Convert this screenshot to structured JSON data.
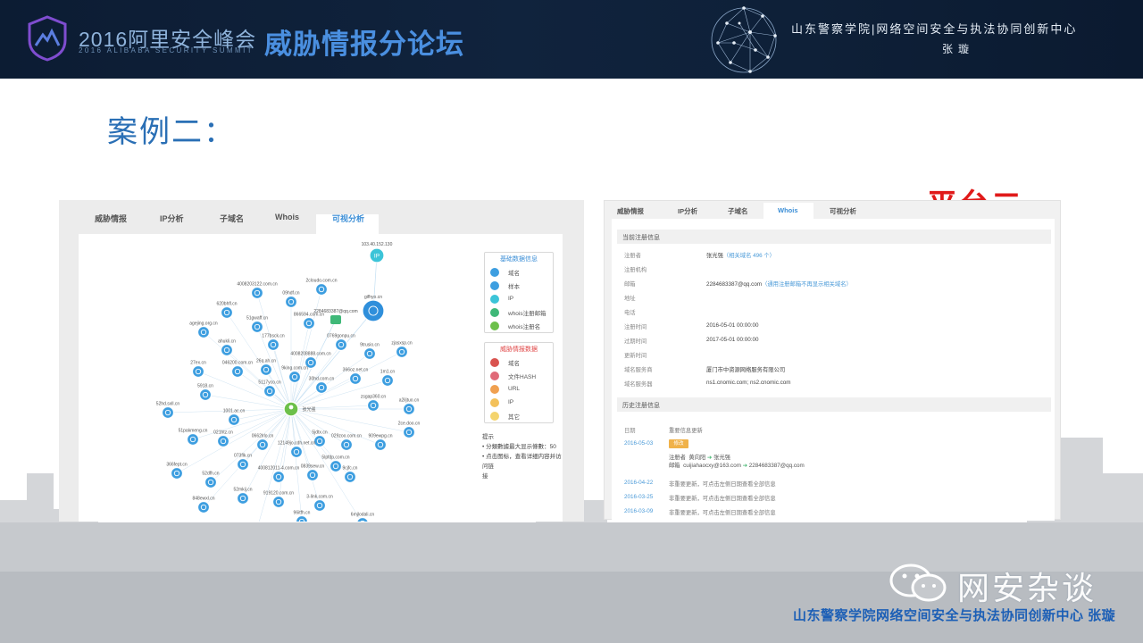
{
  "header": {
    "summit_title": "2016阿里安全峰会",
    "summit_subtitle": "2016 ALIBABA SECURITY SUMMIT",
    "forum_title": "威胁情报分论坛",
    "institution": "山东警察学院|网络空间安全与执法协同创新中心",
    "author": "张璇"
  },
  "slide": {
    "case_title": "案例二：",
    "platform_label": "平台二"
  },
  "left_shot": {
    "tabs": [
      "威胁情报",
      "IP分析",
      "子域名",
      "Whois",
      "可视分析"
    ],
    "active_tab": 4,
    "legend_basic": {
      "title": "基础数据信息",
      "items": [
        "域名",
        "样本",
        "IP",
        "whois注册邮箱",
        "whois注册名"
      ]
    },
    "legend_threat": {
      "title": "威胁情报数据",
      "items": [
        "域名",
        "文件HASH",
        "URL",
        "IP",
        "其它"
      ]
    },
    "hint": {
      "title": "提示",
      "lines": [
        "• 分類數據最大显示條數：50",
        "• 点击图标，查看详细内容并访问链",
        "接"
      ]
    },
    "graph_labels": {
      "ip_node": "103.40.152.130",
      "center": "张光强",
      "email": "2284683387@qq.com",
      "gifhyo": "gifhyo.cn",
      "domains": [
        "4008203122.com.cn",
        "2cloudo.com.cn",
        "620bhfl.cn",
        "09hdf.cn",
        "agejing.org.cn",
        "51gwaff.cn",
        "866594.com.cn",
        "ahukli.cn",
        "177bsck.cn",
        "0769gonpu.cn",
        "9trusio.cn",
        "zjasxsp.cn",
        "27ex.cn",
        "046200.com.cn",
        "26q.ah.cn",
        "4008208888.com.cn",
        "9king.com.cn",
        "5918.cn",
        "5117yco.cn",
        "30hd.com.cn",
        "366oz.net.cn",
        "1m1.cn",
        "52hd.sxll.cn",
        "1001.ac.cn",
        "zsgap360.cn",
        "a2iljtuo.cn",
        "51pakmeng.cn",
        "021htz.cn",
        "0662lrlo.cn",
        "5jdtx.cn",
        "029zoo.com.cn",
        "909ewpg.cn",
        "2ce.doo.cn",
        "12149jo.cdh.net.cn",
        "5lpfdp.com.cn",
        "366fept.cn",
        "52dfh.cn",
        "073flk.cn",
        "400812011-4.com.cn",
        "0839sew.cn",
        "9cjfc.cn",
        "52mkij.cn",
        "848ewxl.cn",
        "919120.com.cn",
        "3-link.com.cn",
        "96itfh.cn",
        "6mjlodali.cn",
        "07899.com.cn"
      ]
    }
  },
  "right_shot": {
    "tabs": [
      "威胁情报",
      "IP分析",
      "子域名",
      "Whois",
      "可视分析"
    ],
    "active_tab": 3,
    "current_title": "当前注册信息",
    "fields": [
      {
        "label": "注册者",
        "value": "张光强",
        "link": "（相关域名 496 个）"
      },
      {
        "label": "注册机构",
        "value": "",
        "link": ""
      },
      {
        "label": "邮箱",
        "value": "2284683387@qq.com",
        "link": "（通用注册邮箱不再显示相关域名）"
      },
      {
        "label": "地址",
        "value": "",
        "link": ""
      },
      {
        "label": "电话",
        "value": "",
        "link": ""
      },
      {
        "label": "注册时间",
        "value": "2016-05-01 00:00:00",
        "link": ""
      },
      {
        "label": "过期时间",
        "value": "2017-05-01 00:00:00",
        "link": ""
      },
      {
        "label": "更新时间",
        "value": "",
        "link": ""
      },
      {
        "label": "域名服务商",
        "value": "厦门市中资源网络服务有限公司",
        "link": ""
      },
      {
        "label": "域名服务器",
        "value": "ns1.cnomic.com; ns2.cnomic.com",
        "link": ""
      }
    ],
    "history_title": "历史注册信息",
    "history_head": {
      "date": "日期",
      "change": "重要信息更新"
    },
    "history_first": {
      "date": "2016-05-03",
      "badge": "修改",
      "reg_label": "注册者",
      "reg_from": "黄向阳",
      "reg_to": "张光强",
      "mail_label": "邮箱",
      "mail_from": "cuijiahaocxy@163.com",
      "mail_to": "2284683387@qq.com"
    },
    "history_rows": [
      {
        "date": "2016-04-22",
        "text": "非重要更新，可点击左侧日期查看全部信息"
      },
      {
        "date": "2016-03-25",
        "text": "非重要更新，可点击左侧日期查看全部信息"
      },
      {
        "date": "2016-03-09",
        "text": "非重要更新，可点击左侧日期查看全部信息"
      }
    ]
  },
  "watermark": {
    "text": "网安杂谈",
    "footer": "山东警察学院网络空间安全与执法协同创新中心  张璇"
  },
  "colors": {
    "banner_bg": "#0c1c33",
    "title_blue": "#2a6fb5",
    "accent_red": "#e01a1a",
    "node_blue": "#3d9ee0",
    "link_blue": "#4a9ad8"
  }
}
